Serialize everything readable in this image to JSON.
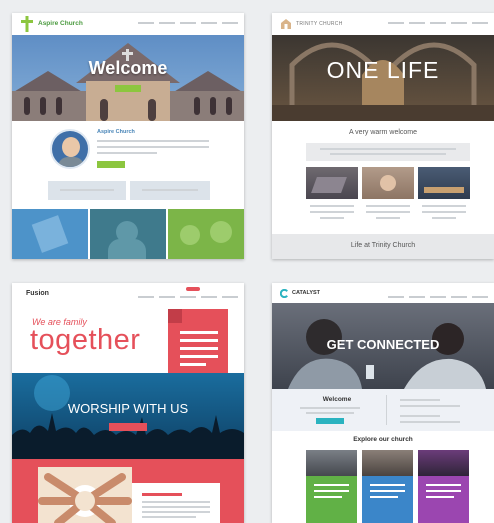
{
  "colors": {
    "aspire_green": "#8cc63f",
    "aspire_sky": "#5e8fc6",
    "trinity_gold": "#d9b48a",
    "fusion_red": "#e5505a",
    "fusion_blue": "#1a6d9e",
    "catalyst_teal": "#2bb3c0"
  },
  "aspire": {
    "logo_text": "Aspire Church",
    "hero_title": "Welcome",
    "profile_name": "Aspire Church",
    "icons": [
      "cross-logo-icon",
      "avatar-photo"
    ]
  },
  "trinity": {
    "logo_text": "TRINITY CHURCH",
    "hero_title": "ONE LIFE",
    "welcome_text": "A very warm welcome",
    "footer_text": "Life at Trinity Church",
    "icons": [
      "church-logo-icon"
    ]
  },
  "fusion": {
    "logo_text": "Fusion",
    "tagline": "We are family",
    "big_word": "together",
    "banner_title": "WORSHIP WITH US"
  },
  "catalyst": {
    "logo_text": "CATALYST",
    "hero_title": "GET CONNECTED",
    "welcome_heading": "Welcome",
    "explore_heading": "Explore our church",
    "icons": [
      "catalyst-c-logo-icon"
    ]
  }
}
